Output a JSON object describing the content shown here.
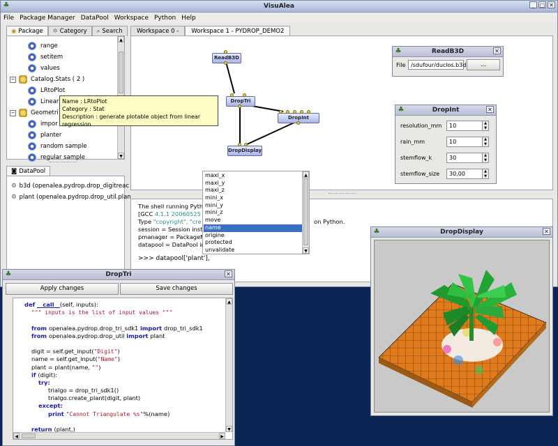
{
  "main_window": {
    "title": "VisuAlea",
    "menu": [
      "File",
      "Package Manager",
      "DataPool",
      "Workspace",
      "Python",
      "Help"
    ]
  },
  "left_tabs": [
    "Package",
    "Category",
    "Search"
  ],
  "package_tree": {
    "items": [
      {
        "label": "range",
        "type": "node"
      },
      {
        "label": "setitem",
        "type": "node"
      },
      {
        "label": "values",
        "type": "node"
      },
      {
        "label": "Catalog.Stats ( 2 )",
        "type": "package"
      },
      {
        "label": "LRtoPlot",
        "type": "node"
      },
      {
        "label": "Linear",
        "type": "node"
      },
      {
        "label": "Geometri",
        "type": "package"
      },
      {
        "label": "impor",
        "type": "node"
      },
      {
        "label": "planter",
        "type": "node"
      },
      {
        "label": "random sample",
        "type": "node"
      },
      {
        "label": "regular sample",
        "type": "node"
      }
    ]
  },
  "tooltip": {
    "name_line": "Name : LRtoPlot",
    "category_line": "Category  : Stat",
    "description_line": "Description : generate plotable object from linear regression"
  },
  "datapool": {
    "tab_label": "DataPool",
    "items": [
      "b3d (openalea.pydrop.drop_digitreac",
      "plant (openalea.pydrop.drop_util.plan"
    ]
  },
  "workspace_tabs": [
    "Workspace 0 -",
    "Workspace 1 - PYDROP_DEMO2"
  ],
  "graph_nodes": {
    "readb3d": "ReadB3D",
    "droptri": "DropTri",
    "dropint": "DropInt",
    "dropdisplay": "DropDisplay"
  },
  "readb3d_dialog": {
    "title": "ReadB3D",
    "file_label": "File",
    "file_value": "/sdufour/duclos.b3d",
    "browse_label": "..."
  },
  "dropint_dialog": {
    "title": "DropInt",
    "params": [
      {
        "label": "resolution_mm",
        "value": "10"
      },
      {
        "label": "rain_mm",
        "value": "10"
      },
      {
        "label": "stemflow_k",
        "value": "30"
      },
      {
        "label": "stemflow_size",
        "value": "30,00"
      }
    ]
  },
  "shell": {
    "line1": "The shell running Python",
    "line2_prefix": "[GCC ",
    "line2_version": "4.1.1 20060525",
    "line2_suffix": " (R",
    "line3_prefix": "Type ",
    "line3_string": "\"copyright\"",
    "line3_cont": ", \"cre",
    "line3_end": "on Python.",
    "line4": " session = Session insta",
    "line5": " pmanager = PackageMa",
    "line6": " datapool = DataPool ins",
    "prompt": ">>> datapool['plant'],"
  },
  "autocomplete": {
    "items": [
      "maxi_x",
      "maxi_y",
      "maxi_z",
      "mini_x",
      "mini_y",
      "mini_z",
      "move",
      "name",
      "origine",
      "protected",
      "unvalidate"
    ],
    "selected": "name"
  },
  "droptri_window": {
    "title": "DropTri",
    "apply_label": "Apply changes",
    "save_label": "Save changes",
    "code": [
      {
        "indent": 1,
        "parts": [
          [
            "kw",
            "def "
          ],
          [
            "fn",
            "__call__"
          ],
          [
            "",
            "(self, inputs):"
          ]
        ]
      },
      {
        "indent": 2,
        "parts": [
          [
            "str",
            "\"\"\" inputs is the list of input values \"\"\""
          ]
        ]
      },
      {
        "indent": 0,
        "parts": [
          [
            "",
            ""
          ]
        ]
      },
      {
        "indent": 2,
        "parts": [
          [
            "kw",
            "from "
          ],
          [
            "",
            "openalea.pydrop.drop_tri_sdk1 "
          ],
          [
            "kw",
            "import "
          ],
          [
            "",
            "drop_tri_sdk1"
          ]
        ]
      },
      {
        "indent": 2,
        "parts": [
          [
            "kw",
            "from "
          ],
          [
            "",
            "openalea.pydrop.drop_util "
          ],
          [
            "kw",
            "import "
          ],
          [
            "",
            "plant"
          ]
        ]
      },
      {
        "indent": 0,
        "parts": [
          [
            "",
            ""
          ]
        ]
      },
      {
        "indent": 2,
        "parts": [
          [
            "",
            "digit = self.get_input("
          ],
          [
            "str",
            "\"Digit\""
          ],
          [
            "",
            ")"
          ]
        ]
      },
      {
        "indent": 2,
        "parts": [
          [
            "",
            "name = self.get_input("
          ],
          [
            "str",
            "\"Name\""
          ],
          [
            "",
            ")"
          ]
        ]
      },
      {
        "indent": 2,
        "parts": [
          [
            "",
            "plant = plant(name, "
          ],
          [
            "str",
            "\"\""
          ],
          [
            "",
            ")"
          ]
        ]
      },
      {
        "indent": 2,
        "parts": [
          [
            "kw",
            "if "
          ],
          [
            "",
            "(digit):"
          ]
        ]
      },
      {
        "indent": 3,
        "parts": [
          [
            "kw",
            "try:"
          ]
        ]
      },
      {
        "indent": 4,
        "parts": [
          [
            "",
            "trialgo = drop_tri_sdk1()"
          ]
        ]
      },
      {
        "indent": 4,
        "parts": [
          [
            "",
            "trialgo.create_plant(digit, plant)"
          ]
        ]
      },
      {
        "indent": 3,
        "parts": [
          [
            "kw",
            "except:"
          ]
        ]
      },
      {
        "indent": 4,
        "parts": [
          [
            "kw",
            "print "
          ],
          [
            "str",
            "\"Cannot Triangulate %s\""
          ],
          [
            "",
            "%(name)"
          ]
        ]
      },
      {
        "indent": 0,
        "parts": [
          [
            "",
            ""
          ]
        ]
      },
      {
        "indent": 2,
        "parts": [
          [
            "kw",
            "return "
          ],
          [
            "",
            "(plant,)"
          ]
        ]
      }
    ]
  },
  "dropdisplay_window": {
    "title": "DropDisplay"
  }
}
